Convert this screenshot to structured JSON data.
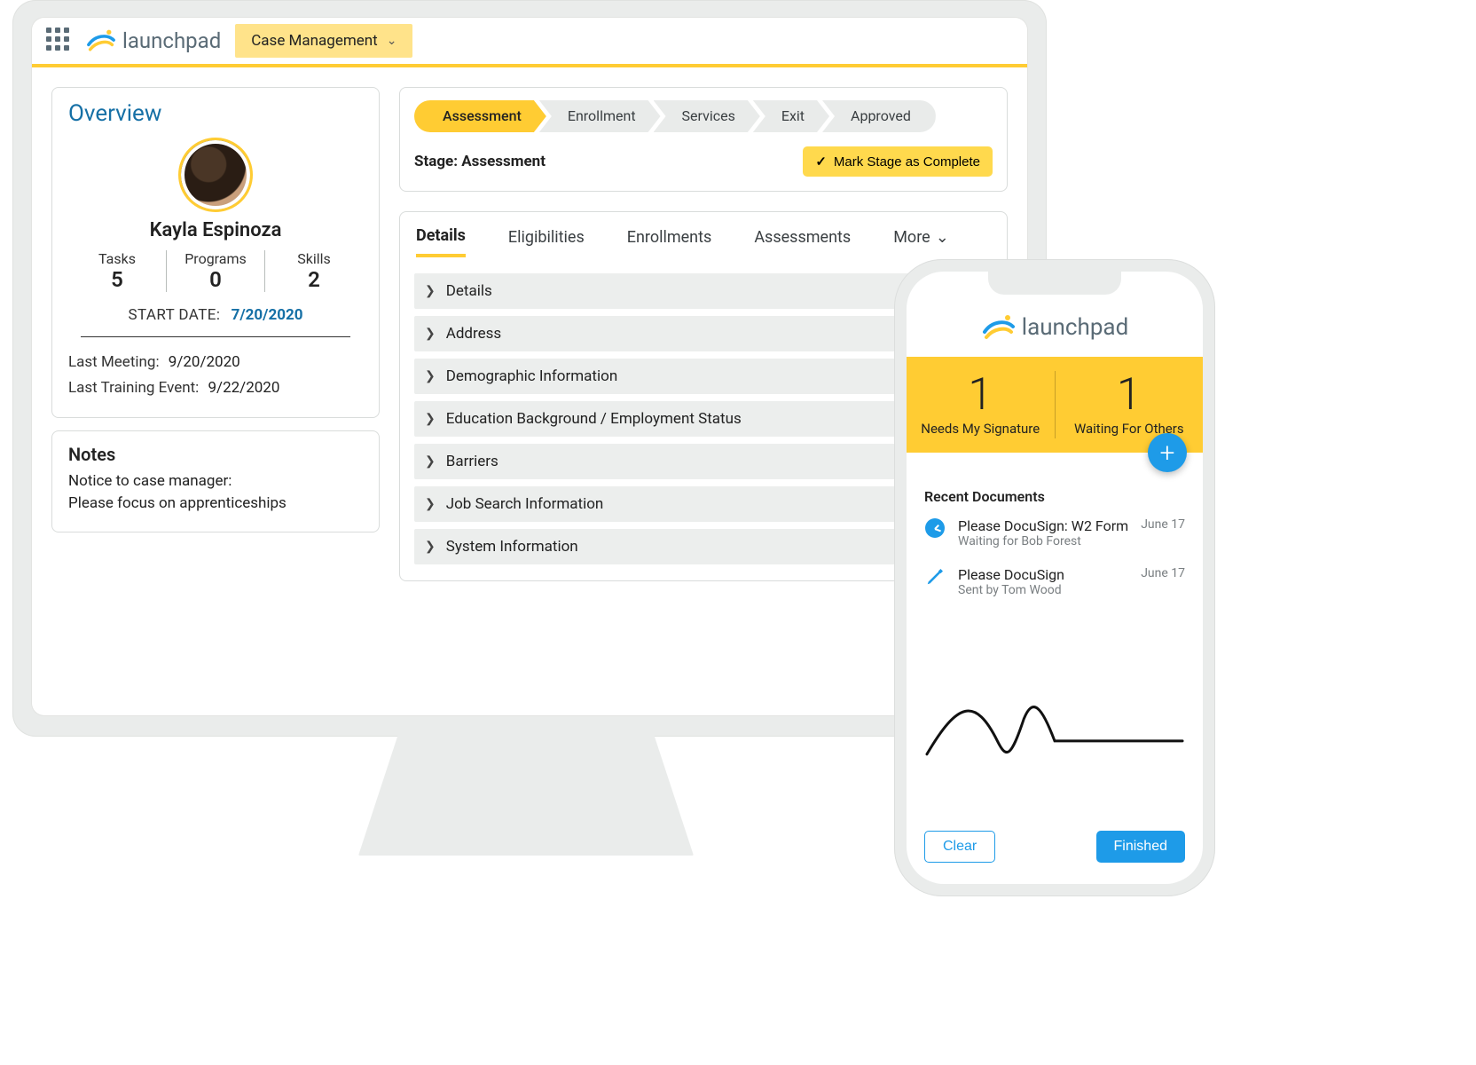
{
  "brand": "launchpad",
  "nav": {
    "case_management": "Case Management"
  },
  "overview": {
    "title": "Overview",
    "name": "Kayla Espinoza",
    "stats": {
      "tasks_label": "Tasks",
      "tasks_value": "5",
      "programs_label": "Programs",
      "programs_value": "0",
      "skills_label": "Skills",
      "skills_value": "2"
    },
    "start_date_label": "START DATE:",
    "start_date_value": "7/20/2020",
    "last_meeting_label": "Last Meeting:",
    "last_meeting_value": "9/20/2020",
    "last_training_label": "Last Training Event:",
    "last_training_value": "9/22/2020"
  },
  "notes": {
    "heading": "Notes",
    "line1": "Notice to case manager:",
    "line2": "Please focus on apprenticeships"
  },
  "path": {
    "steps": [
      "Assessment",
      "Enrollment",
      "Services",
      "Exit",
      "Approved"
    ],
    "active_index": 0,
    "stage_label": "Stage: Assessment",
    "complete_button": "Mark Stage as Complete"
  },
  "tabs": {
    "items": [
      "Details",
      "Eligibilities",
      "Enrollments",
      "Assessments"
    ],
    "more": "More",
    "active_index": 0
  },
  "accordion": [
    "Details",
    "Address",
    "Demographic Information",
    "Education Background / Employment Status",
    "Barriers",
    "Job Search Information",
    "System Information"
  ],
  "phone": {
    "counts": {
      "needs_signature_value": "1",
      "needs_signature_label": "Needs My Signature",
      "waiting_value": "1",
      "waiting_label": "Waiting For Others"
    },
    "recent_heading": "Recent Documents",
    "docs": [
      {
        "title": "Please DocuSign: W2 Form",
        "subtitle": "Waiting for Bob Forest",
        "date": "June 17"
      },
      {
        "title": "Please DocuSign",
        "subtitle": "Sent by Tom Wood",
        "date": "June 17"
      }
    ],
    "clear": "Clear",
    "finished": "Finished"
  }
}
